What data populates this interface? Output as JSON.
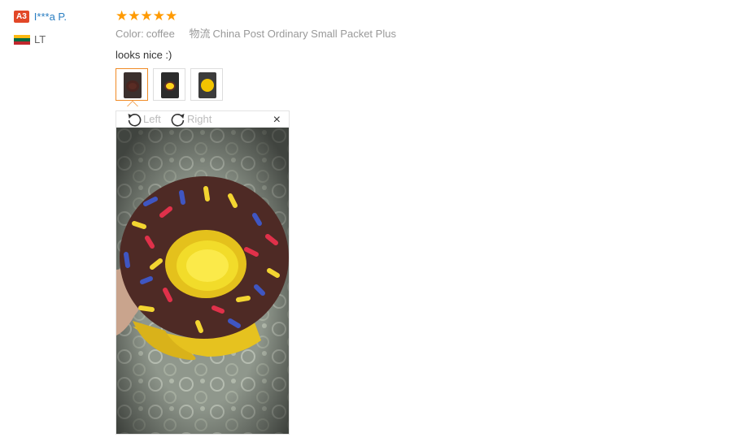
{
  "user": {
    "level": "A3",
    "name": "I***a P.",
    "country": "LT"
  },
  "review": {
    "stars": "★★★★★",
    "color_label": "Color:",
    "color_value": "coffee",
    "shipping_label": "物流",
    "shipping_value": "China Post Ordinary Small Packet Plus",
    "text": "looks nice :)"
  },
  "viewer": {
    "rotate_left": "Left",
    "rotate_right": "Right",
    "close": "×"
  },
  "colors": {
    "accent": "#f08a24",
    "star": "#ff9a00",
    "link": "#2a7ec2",
    "badge": "#e24727"
  },
  "icons": [
    "rotate-left-icon",
    "rotate-right-icon",
    "close-icon",
    "flag-icon"
  ]
}
